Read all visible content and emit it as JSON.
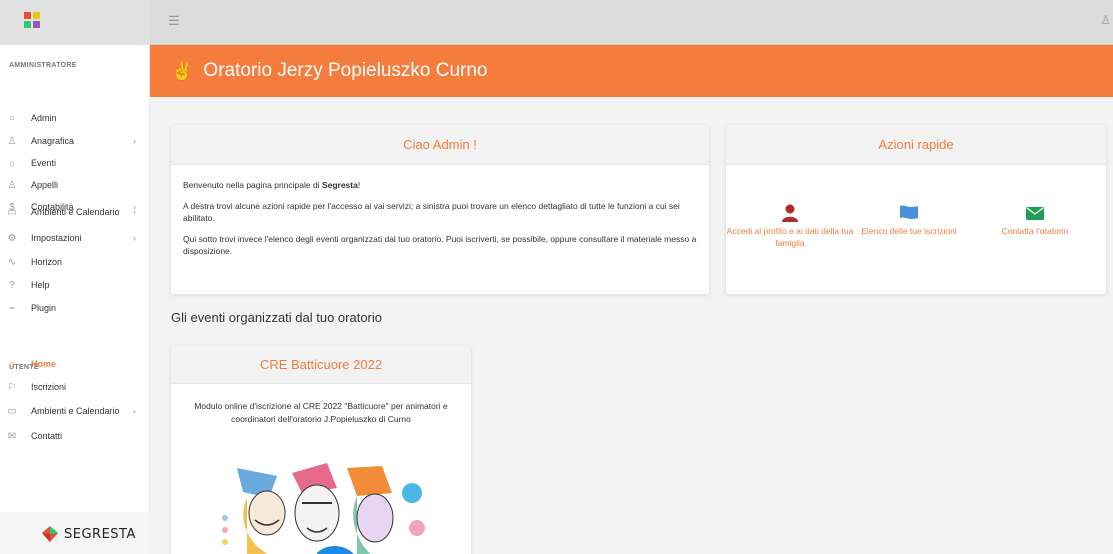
{
  "topbar": {
    "menu_icon": "hamburger-icon",
    "user_icon": "user-icon"
  },
  "sidebar": {
    "admin_section": "AMMINISTRATORE",
    "admin_items": [
      {
        "label": "Admin",
        "icon": "circle-icon"
      },
      {
        "label": "Anagrafica",
        "icon": "user-icon",
        "has_submenu": true
      },
      {
        "label": "Eventi",
        "icon": "sun-icon"
      },
      {
        "label": "Appelli",
        "icon": "users-icon"
      },
      {
        "label": "Contabilità",
        "icon": "dollar-icon",
        "has_submenu": true
      },
      {
        "label": "Ambienti e Calendario",
        "icon": "calendar-icon",
        "has_submenu": true
      },
      {
        "label": "Impostazioni",
        "icon": "gear-icon",
        "has_submenu": true
      },
      {
        "label": "Horizon",
        "icon": "pulse-icon"
      },
      {
        "label": "Help",
        "icon": "help-icon"
      },
      {
        "label": "Plugin",
        "icon": "plugin-icon"
      }
    ],
    "user_section": "UTENTE",
    "user_items": [
      {
        "label": "Home",
        "icon": "home-icon",
        "active": true
      },
      {
        "label": "Iscrizioni",
        "icon": "flag-icon"
      },
      {
        "label": "Ambienti e Calendario",
        "icon": "calendar-icon",
        "has_submenu": true
      },
      {
        "label": "Contatti",
        "icon": "mail-icon"
      }
    ],
    "brand": "SEGRESTA"
  },
  "header": {
    "title": "Oratorio Jerzy Popieluszko Curno",
    "icon": "hand-peace-icon"
  },
  "welcome_card": {
    "title": "Ciao Admin !",
    "p1_pre": "Benvenuto nella pagina principale di ",
    "p1_bold": "Segresta",
    "p1_post": "!",
    "p2": "A destra trovi alcune azioni rapide per l'accesso ai vai servizi; a sinistra puoi trovare un elenco dettagliato di tutte le funzioni a cui sei abilitato.",
    "p3": "Qui sotto trovi invece l'elenco degli eventi organizzati dal tuo oratorio. Puoi iscriverti, se possibile, oppure consultare il materiale messo a disposizione."
  },
  "quick_actions": {
    "title": "Azioni rapide",
    "items": [
      {
        "label": "Accedi al profilo e ai dati della tua famiglia",
        "icon": "user-icon",
        "color": "#b12a2a"
      },
      {
        "label": "Elenco delle tue iscrizioni",
        "icon": "flag-icon",
        "color": "#4a90d9"
      },
      {
        "label": "Contatta l'oratorio",
        "icon": "envelope-icon",
        "color": "#1f9d55"
      }
    ]
  },
  "events_section": {
    "title": "Gli eventi organizzati dal tuo oratorio"
  },
  "event_card": {
    "title": "CRE Batticuore 2022",
    "description": "Modulo online d'iscrizione al CRE 2022 \"Batticuore\" per animatori e coordinatori dell'oratorio J.Popieluszko di Curno"
  },
  "colors": {
    "accent": "#f47c3c"
  }
}
